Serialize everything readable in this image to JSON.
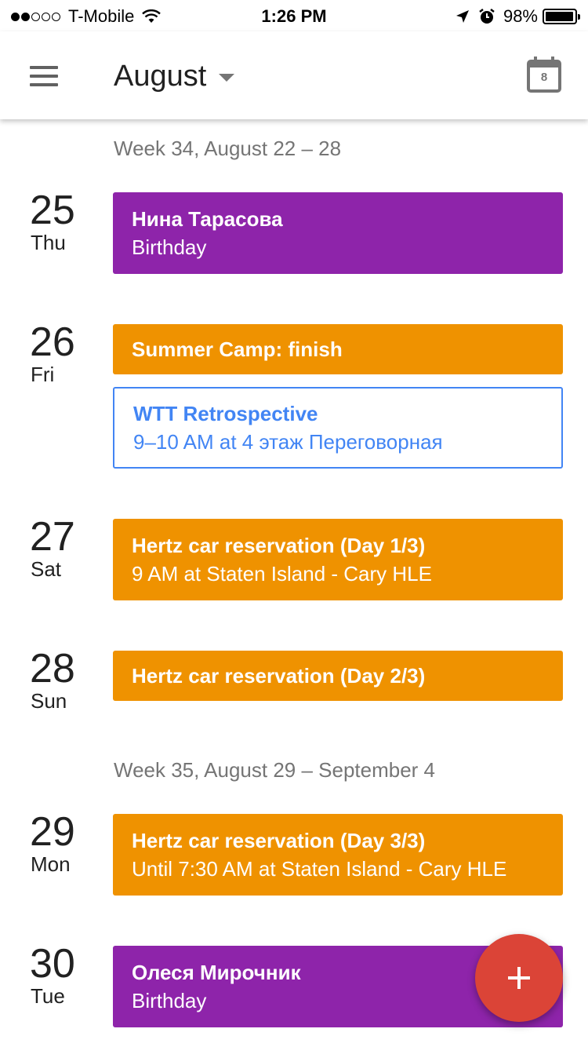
{
  "status_bar": {
    "signal_filled": 2,
    "signal_total": 5,
    "carrier": "T-Mobile",
    "time": "1:26 PM",
    "battery_percent": "98%",
    "battery_level": 0.98
  },
  "app_bar": {
    "month": "August",
    "today_day": "8"
  },
  "weeks": [
    {
      "label": "Week 34, August 22 – 28"
    },
    {
      "label": "Week 35, August 29 – September 4"
    }
  ],
  "days": [
    {
      "num": "25",
      "name": "Thu",
      "events": [
        {
          "title": "Нина Тарасова",
          "subtitle": "Birthday",
          "color": "#8e24aa"
        }
      ]
    },
    {
      "num": "26",
      "name": "Fri",
      "events": [
        {
          "title": "Summer Camp: finish",
          "color": "#ef9200"
        },
        {
          "title": "WTT Retrospective",
          "subtitle": "9–10 AM at 4 этаж Переговорная",
          "color": "#4285f4",
          "style": "outlined"
        }
      ]
    },
    {
      "num": "27",
      "name": "Sat",
      "events": [
        {
          "title": "Hertz car reservation (Day 1/3)",
          "subtitle": "9 AM at Staten Island - Cary HLE",
          "color": "#ef9200"
        }
      ]
    },
    {
      "num": "28",
      "name": "Sun",
      "events": [
        {
          "title": "Hertz car reservation (Day 2/3)",
          "color": "#ef9200"
        }
      ]
    },
    {
      "num": "29",
      "name": "Mon",
      "events": [
        {
          "title": "Hertz car reservation (Day 3/3)",
          "subtitle": "Until 7:30 AM at Staten Island - Cary HLE",
          "color": "#ef9200"
        }
      ]
    },
    {
      "num": "30",
      "name": "Tue",
      "events": [
        {
          "title": "Олеся Мирочник",
          "subtitle": "Birthday",
          "color": "#8e24aa"
        }
      ]
    }
  ],
  "icons": {
    "menu": "hamburger-menu-icon",
    "dropdown": "caret-down-icon",
    "today": "calendar-today-icon",
    "location": "location-arrow-icon",
    "alarm": "alarm-icon",
    "wifi": "wifi-icon",
    "add": "plus-icon"
  },
  "colors": {
    "birthday": "#8e24aa",
    "event_orange": "#ef9200",
    "event_blue": "#4285f4",
    "fab": "#db4437"
  }
}
